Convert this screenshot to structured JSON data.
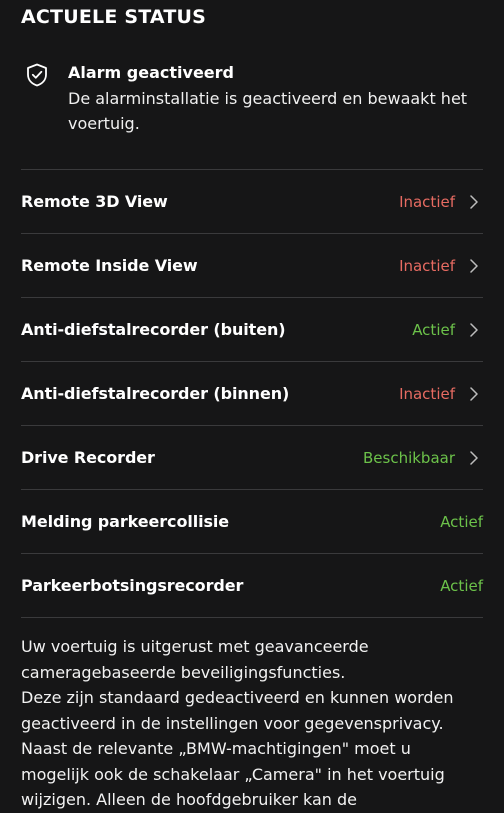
{
  "section": {
    "title": "ACTUELE STATUS"
  },
  "alarm": {
    "icon": "shield-check-icon",
    "title": "Alarm geactiveerd",
    "description": "De alarminstallatie is geactiveerd en bewaakt het voertuig."
  },
  "rows": [
    {
      "label": "Remote 3D View",
      "status": "Inactief",
      "state": "inactive",
      "chevron": true
    },
    {
      "label": "Remote Inside View",
      "status": "Inactief",
      "state": "inactive",
      "chevron": true
    },
    {
      "label": "Anti-diefstalrecorder (buiten)",
      "status": "Actief",
      "state": "active",
      "chevron": true
    },
    {
      "label": "Anti-diefstalrecorder (binnen)",
      "status": "Inactief",
      "state": "inactive",
      "chevron": true
    },
    {
      "label": "Drive Recorder",
      "status": "Beschikbaar",
      "state": "active",
      "chevron": true
    },
    {
      "label": "Melding parkeercollisie",
      "status": "Actief",
      "state": "active",
      "chevron": false
    },
    {
      "label": "Parkeerbotsingsrecorder",
      "status": "Actief",
      "state": "active",
      "chevron": false
    }
  ],
  "colors": {
    "background": "#161617",
    "inactive": "#e76b62",
    "active": "#6cc24a",
    "divider": "#3a3a3c"
  },
  "info": {
    "line1": "Uw voertuig is uitgerust met geavanceerde cameragebaseerde beveiligingsfuncties.",
    "line2": "Deze zijn standaard gedeactiveerd en kunnen worden geactiveerd in de instellingen voor gegevensprivacy.",
    "line3": "Naast de relevante „BMW-machtigingen\" moet u mogelijk ook de schakelaar „Camera\" in het voertuig wijzigen. Alleen de hoofdgebruiker kan de"
  }
}
